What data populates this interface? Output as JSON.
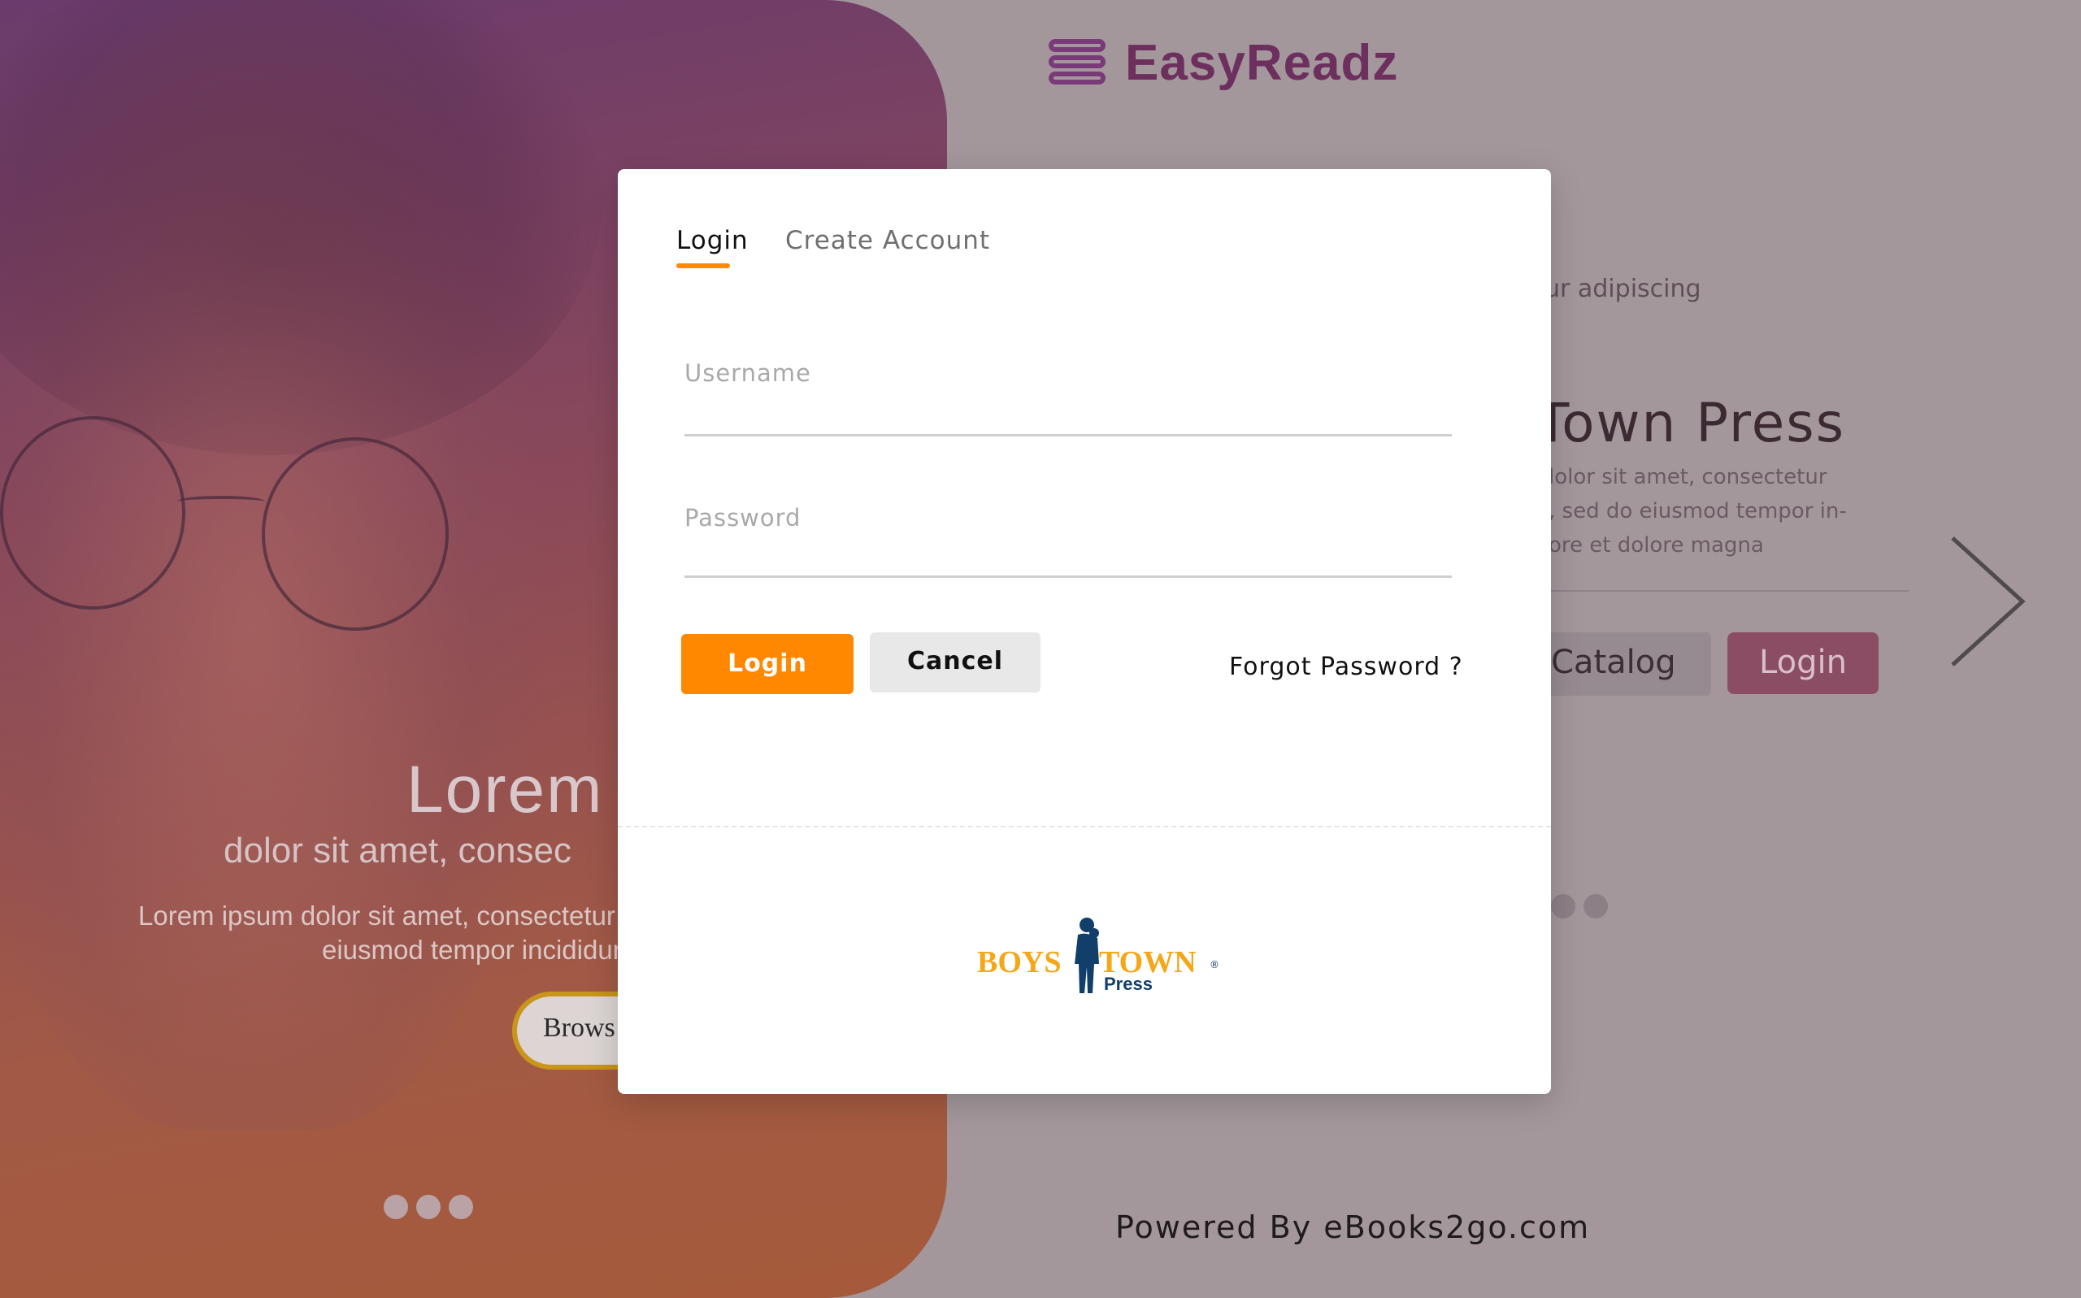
{
  "brand": {
    "name": "EasyReadz",
    "colors": {
      "primary": "#6d2f5e",
      "accent": "#ff8800"
    }
  },
  "hero": {
    "title": "Lorem",
    "subtitle": "dolor sit amet, consec",
    "description_line1": "Lorem ipsum dolor sit amet, consectetur ad",
    "description_line2": "eiusmod tempor incididunt",
    "browse_label": "Brows"
  },
  "background_panel": {
    "tagline": "ur adipiscing",
    "title": "Town Press",
    "desc_line1": "lolor sit amet, consectetur",
    "desc_line2": ", sed do eiusmod tempor in-",
    "desc_line3": "ore et dolore magna",
    "catalog_label": "Catalog",
    "login_label": "Login"
  },
  "footer": {
    "powered_by": "Powered By eBooks2go.com"
  },
  "modal": {
    "tabs": [
      {
        "label": "Login",
        "active": true
      },
      {
        "label": "Create Account",
        "active": false
      }
    ],
    "username": {
      "placeholder": "Username",
      "value": ""
    },
    "password": {
      "placeholder": "Password",
      "value": ""
    },
    "login_button": "Login",
    "cancel_button": "Cancel",
    "forgot_link": "Forgot Password ?",
    "partner_logo": {
      "word1": "BOYS",
      "word2": "TOWN",
      "word3": "Press",
      "registered": "®"
    }
  }
}
